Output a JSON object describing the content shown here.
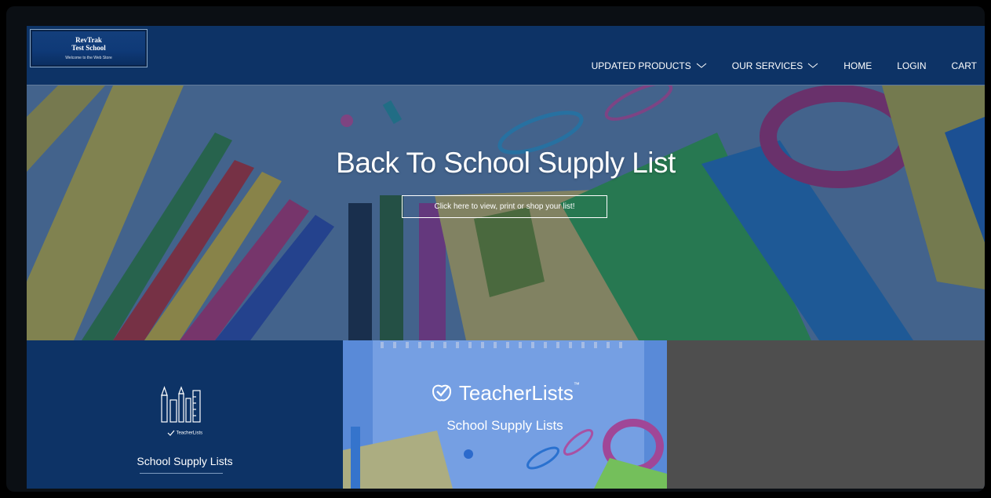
{
  "logo": {
    "line1": "RevTrak",
    "line2": "Test School",
    "tagline": "Welcome to the Web Store"
  },
  "nav": {
    "items": [
      {
        "label": "UPDATED PRODUCTS",
        "dropdown": true
      },
      {
        "label": "OUR SERVICES",
        "dropdown": true
      },
      {
        "label": "HOME",
        "dropdown": false
      },
      {
        "label": "LOGIN",
        "dropdown": false
      },
      {
        "label": "CART",
        "dropdown": false
      }
    ]
  },
  "hero": {
    "title": "Back To School Supply List",
    "button_label": "Click here to view, print or shop your list!"
  },
  "tiles": {
    "tile1": {
      "brand": "TeacherLists",
      "title": "School Supply Lists"
    },
    "tile2": {
      "brand": "TeacherLists",
      "trademark": "™",
      "title": "School Supply Lists"
    }
  },
  "colors": {
    "header_bg": "#0d3366",
    "tile_dark_bg": "#4e4e4e",
    "accent_green": "#8ee03a"
  }
}
